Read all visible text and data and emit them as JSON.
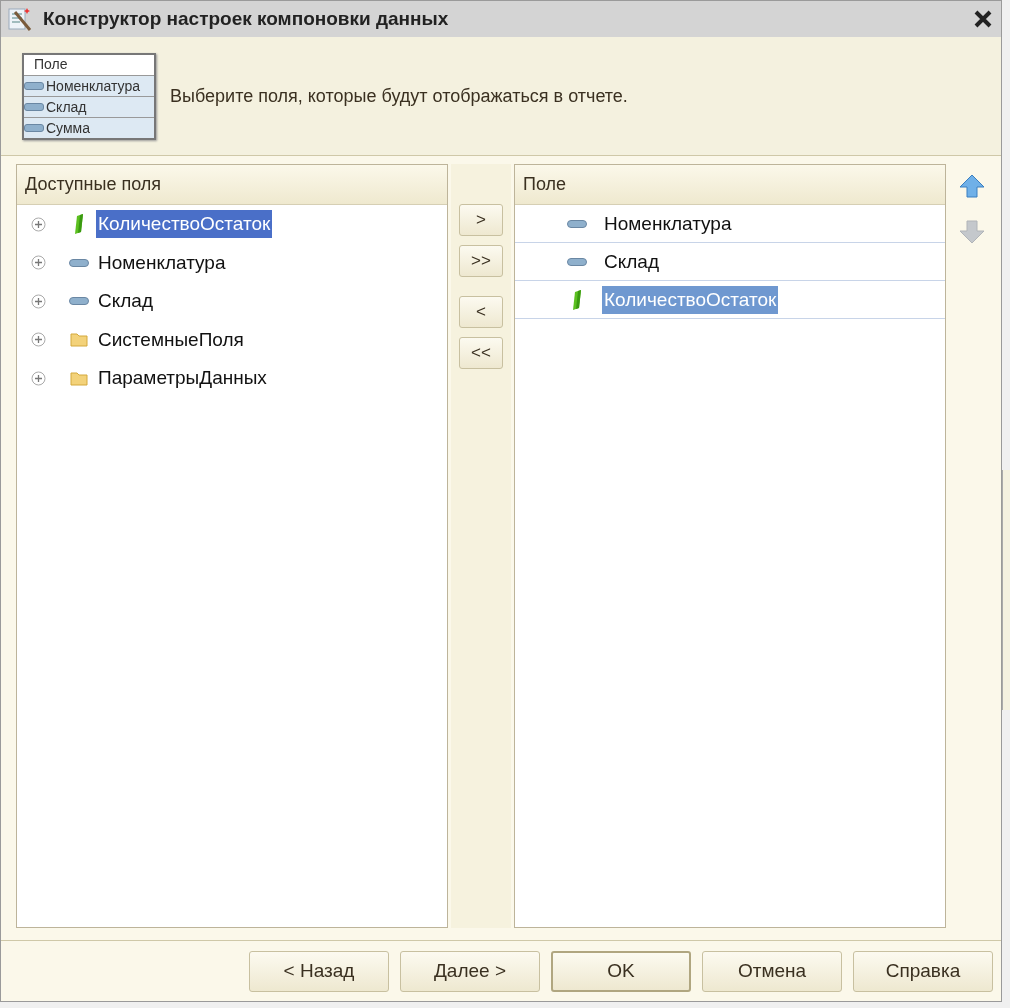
{
  "window": {
    "title": "Конструктор настроек компоновки данных"
  },
  "header": {
    "picture": {
      "heading": "Поле",
      "rows": [
        "Номенклатура",
        "Склад",
        "Сумма"
      ]
    },
    "text": "Выберите поля, которые будут отображаться в отчете."
  },
  "available": {
    "title": "Доступные поля",
    "items": [
      {
        "label": "КоличествоОстаток",
        "kind": "resource",
        "selected": true,
        "expanded": false
      },
      {
        "label": "Номенклатура",
        "kind": "field",
        "selected": false,
        "expanded": false
      },
      {
        "label": "Склад",
        "kind": "field",
        "selected": false,
        "expanded": false
      },
      {
        "label": "СистемныеПоля",
        "kind": "folder",
        "selected": false,
        "expanded": false
      },
      {
        "label": "ПараметрыДанных",
        "kind": "folder",
        "selected": false,
        "expanded": false
      }
    ]
  },
  "move_buttons": [
    ">",
    ">>",
    "<",
    "<<"
  ],
  "selected_fields": {
    "title": "Поле",
    "items": [
      {
        "label": "Номенклатура",
        "kind": "field",
        "selected": false
      },
      {
        "label": "Склад",
        "kind": "field",
        "selected": false
      },
      {
        "label": "КоличествоОстаток",
        "kind": "resource",
        "selected": true
      }
    ]
  },
  "order_buttons": [
    {
      "kind": "up",
      "disabled": false
    },
    {
      "kind": "down",
      "disabled": true
    }
  ],
  "buttons": [
    {
      "label": "< Назад",
      "default": false
    },
    {
      "label": "Далее >",
      "default": false
    },
    {
      "label": "OK",
      "default": true
    },
    {
      "label": "Отмена",
      "default": false
    },
    {
      "label": "Справка",
      "default": false
    }
  ]
}
